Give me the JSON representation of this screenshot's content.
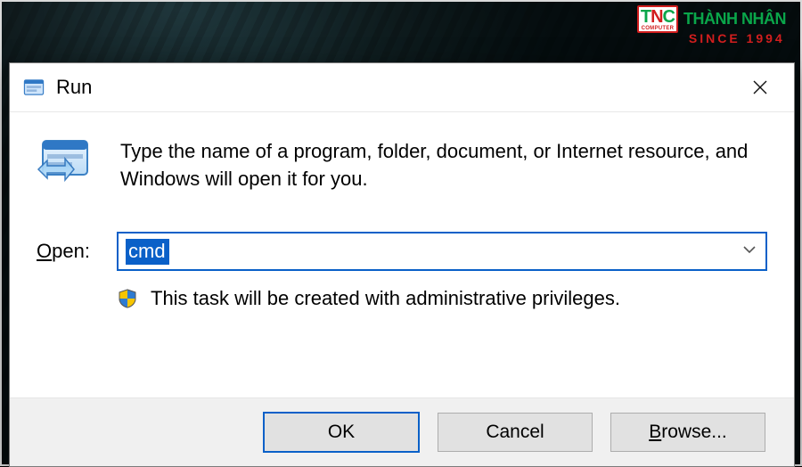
{
  "watermark": {
    "tnc_t": "T",
    "tnc_n": "N",
    "tnc_c": "C",
    "computer": "COMPUTER",
    "brand": "THÀNH NHÂN",
    "since": "SINCE 1994"
  },
  "dialog": {
    "title": "Run",
    "description": "Type the name of a program, folder, document, or Internet resource, and Windows will open it for you.",
    "open_label_underline": "O",
    "open_label_rest": "pen:",
    "input_value": "cmd",
    "admin_note": "This task will be created with administrative privileges.",
    "buttons": {
      "ok": "OK",
      "cancel": "Cancel",
      "browse_underline": "B",
      "browse_rest": "rowse..."
    }
  }
}
